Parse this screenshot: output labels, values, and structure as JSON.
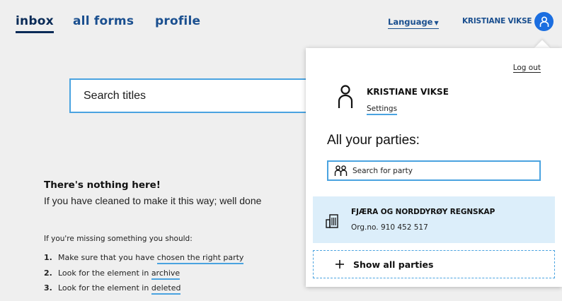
{
  "nav": {
    "items": [
      {
        "label": "inbox",
        "active": true
      },
      {
        "label": "all forms",
        "active": false
      },
      {
        "label": "profile",
        "active": false
      }
    ],
    "language_label": "Language",
    "user_name": "KRISTIANE VIKSE"
  },
  "search": {
    "value": "Search titles"
  },
  "empty_state": {
    "title": "There's nothing here!",
    "subtitle": "If you have cleaned to make it this way; well done",
    "missing_intro": "If you're missing something you should:",
    "steps": [
      {
        "num": "1.",
        "text": "Make sure that you have ",
        "link": "chosen the right party"
      },
      {
        "num": "2.",
        "text": "Look for the element in ",
        "link": "archive"
      },
      {
        "num": "3.",
        "text": "Look for the element in ",
        "link": "deleted"
      }
    ]
  },
  "profile_menu": {
    "logout_label": "Log out",
    "user_name": "KRISTIANE VIKSE",
    "settings_label": "Settings",
    "parties_heading": "All your parties:",
    "party_search_placeholder": "Search for party",
    "parties": [
      {
        "name": "FJÆRA OG NORDDYRØY REGNSKAP",
        "org": "Org.no. 910 452 517"
      }
    ],
    "show_all_label": "Show all parties"
  },
  "colors": {
    "brand_blue": "#1b6ee0",
    "accent_blue": "#4aa3e0",
    "nav_blue": "#1a4f8f",
    "party_bg": "#dceefa"
  }
}
